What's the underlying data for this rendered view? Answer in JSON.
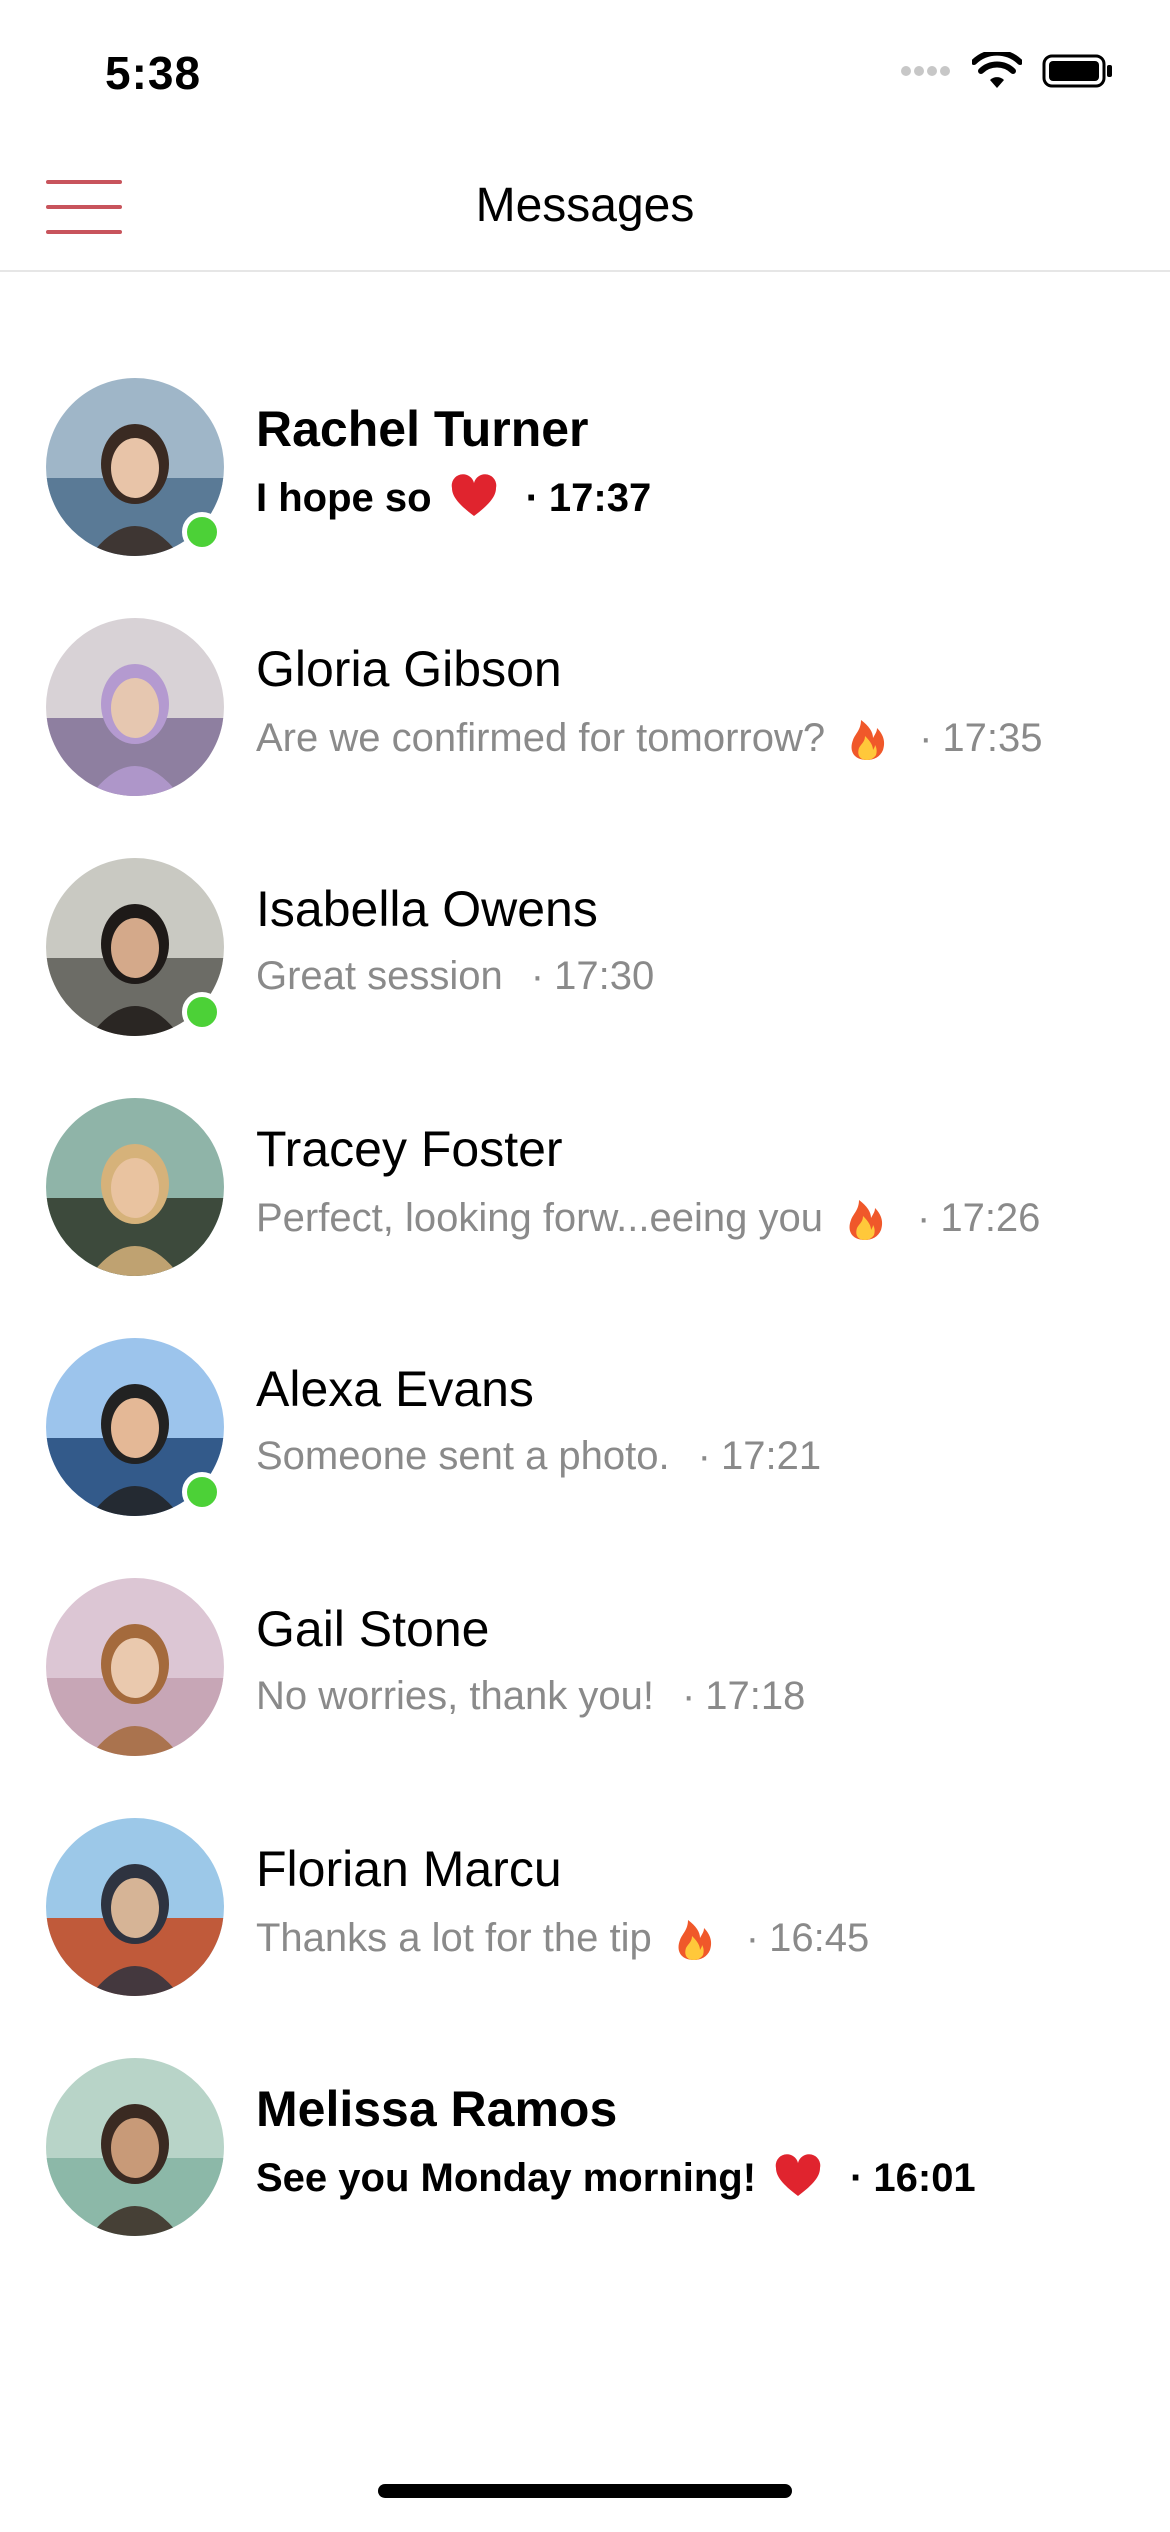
{
  "status_bar": {
    "time": "5:38"
  },
  "nav": {
    "title": "Messages"
  },
  "separator": "·",
  "conversations": [
    {
      "name": "Rachel Turner",
      "message": "I hope so",
      "emoji": "heart-emoji",
      "time": "17:37",
      "unread": true,
      "online": true
    },
    {
      "name": "Gloria Gibson",
      "message": "Are we confirmed for tomorrow?",
      "emoji": "fire-emoji",
      "time": "17:35",
      "unread": false,
      "online": false
    },
    {
      "name": "Isabella Owens",
      "message": "Great session",
      "emoji": null,
      "time": "17:30",
      "unread": false,
      "online": true
    },
    {
      "name": "Tracey Foster",
      "message": "Perfect, looking forw...eeing you",
      "emoji": "fire-emoji",
      "time": "17:26",
      "unread": false,
      "online": false
    },
    {
      "name": "Alexa Evans",
      "message": "Someone sent a photo.",
      "emoji": null,
      "time": "17:21",
      "unread": false,
      "online": true
    },
    {
      "name": "Gail Stone",
      "message": "No worries, thank you!",
      "emoji": null,
      "time": "17:18",
      "unread": false,
      "online": false
    },
    {
      "name": "Florian Marcu",
      "message": "Thanks a lot for the tip",
      "emoji": "fire-emoji",
      "time": "16:45",
      "unread": false,
      "online": false
    },
    {
      "name": "Melissa Ramos",
      "message": "See you Monday morning!",
      "emoji": "heart-emoji",
      "time": "16:01",
      "unread": true,
      "online": false
    }
  ],
  "colors": {
    "accent": "#c8545c",
    "online": "#4cd137",
    "secondary_text": "#8a8a8a"
  }
}
